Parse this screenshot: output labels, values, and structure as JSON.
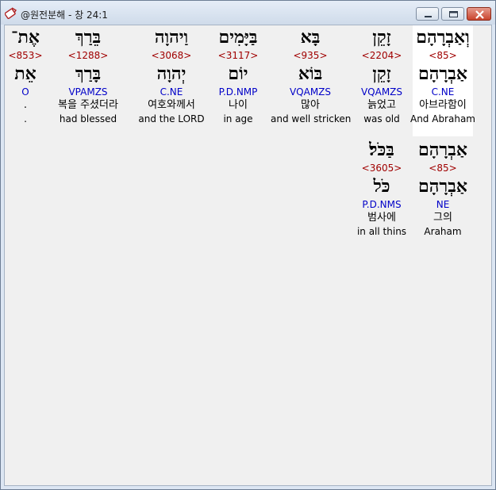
{
  "window": {
    "title": "@원전분해 - 창 24:1",
    "buttons": {
      "minimize": "minimize-icon",
      "maximize": "maximize-icon",
      "close": "close-icon"
    }
  },
  "row1": [
    {
      "heb_pointed": "וְאַבְרָהָם",
      "strong": "<85>",
      "heb_lemma": "אַבְרָהָם",
      "morph": "C.NE",
      "ko": "아브라함이",
      "en": "And Abraham",
      "selected": true
    },
    {
      "heb_pointed": "זָקֵן",
      "strong": "<2204>",
      "heb_lemma": "זָקֵן",
      "morph": "VQAMZS",
      "ko": "늙었고",
      "en": "was old"
    },
    {
      "heb_pointed": "בָּא",
      "strong": "<935>",
      "heb_lemma": "בּוֹא",
      "morph": "VQAMZS",
      "ko": "많아",
      "en": "and well stricken"
    },
    {
      "heb_pointed": "בַּיָּמִים",
      "strong": "<3117>",
      "heb_lemma": "יוֹם",
      "morph": "P.D.NMP",
      "ko": "나이",
      "en": "in age"
    },
    {
      "heb_pointed": "וַיהוָה",
      "strong": "<3068>",
      "heb_lemma": "יְהוָה",
      "morph": "C.NE",
      "ko": "여호와께서",
      "en": "and the LORD"
    },
    {
      "heb_pointed": "בֵּרַךְ",
      "strong": "<1288>",
      "heb_lemma": "בָּרַךְ",
      "morph": "VPAMZS",
      "ko": "복을 주셨더라",
      "en": "had blessed"
    },
    {
      "heb_pointed": "אֶת־",
      "strong": "<853>",
      "heb_lemma": "אֵת",
      "morph": "O",
      "ko": ".",
      "en": "."
    }
  ],
  "row2": [
    {
      "heb_pointed": "אַבְרָהָם",
      "strong": "<85>",
      "heb_lemma": "אַבְרָהָם",
      "morph": "NE",
      "ko": "그의",
      "en": "Araham"
    },
    {
      "heb_pointed": "בַּכֹּל׃",
      "strong": "<3605>",
      "heb_lemma": "כֹּל",
      "morph": "P.D.NMS",
      "ko": "범사에",
      "en": "in all thins"
    }
  ]
}
